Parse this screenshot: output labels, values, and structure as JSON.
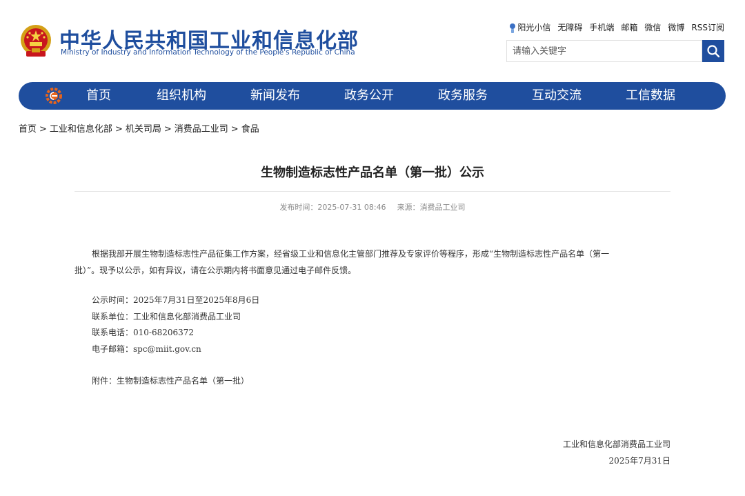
{
  "header": {
    "title_cn": "中华人民共和国工业和信息化部",
    "title_en": "Ministry of Industry and Information Technology of the People's Republic of China",
    "emblem_icon": "national-emblem-icon",
    "top_links": [
      "阳光小信",
      "无障碍",
      "手机端",
      "邮箱",
      "微信",
      "微博",
      "RSS订阅"
    ],
    "search": {
      "placeholder": "请输入关键字",
      "value": ""
    },
    "brand_color": "#1f4e9e"
  },
  "nav": {
    "logo_icon": "miit-logo-icon",
    "items": [
      "首页",
      "组织机构",
      "新闻发布",
      "政务公开",
      "政务服务",
      "互动交流",
      "工信数据"
    ]
  },
  "breadcrumb": [
    "首页",
    "工业和信息化部",
    "机关司局",
    "消费品工业司",
    "食品"
  ],
  "article": {
    "title": "生物制造标志性产品名单（第一批）公示",
    "publish_time": "发布时间：2025-07-31 08:46",
    "source": "来源：消费品工业司",
    "para1_line1": "根据我部开展生物制造标志性产品征集工作方案，经省级工业和信息化主管部门推荐及专家评价等程序，形成“生物制造标志性产品名单（第一",
    "para1_line2": "批）”。现予以公示，如有异议，请在公示期内将书面意见通过电子邮件反馈。",
    "notice_period": "公示时间：2025年7月31日至2025年8月6日",
    "contact_unit": "联系单位：工业和信息化部消费品工业司",
    "contact_phone": "联系电话：010-68206372",
    "email": "电子邮箱：spc@miit.gov.cn",
    "attachment": "附件：生物制造标志性产品名单（第一批）",
    "signature_org": "工业和信息化部消费品工业司",
    "signature_date": "2025年7月31日"
  }
}
